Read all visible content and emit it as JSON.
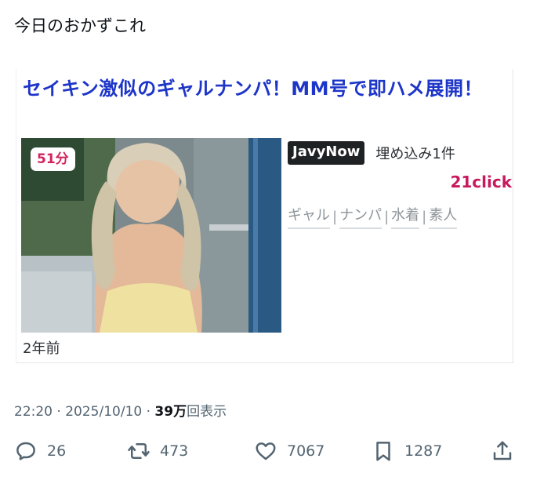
{
  "tweet": {
    "text": "今日のおかずこれ"
  },
  "card": {
    "title": "セイキン激似のギャルナンパ！MM号で即ハメ展開！",
    "duration": "51分",
    "age": "2年前",
    "source": "JavyNow",
    "embed_count": "埋め込み1件",
    "clicks": "21click",
    "tags": [
      "ギャル",
      "ナンパ",
      "水着",
      "素人"
    ]
  },
  "meta": {
    "time": "22:20",
    "date": "2025/10/10",
    "views": "39万",
    "views_suffix": "回表示"
  },
  "actions": {
    "replies": "26",
    "reposts": "473",
    "likes": "7067",
    "bookmarks": "1287"
  },
  "icons": {
    "reply": "reply-icon",
    "repost": "repost-icon",
    "like": "heart-icon",
    "bookmark": "bookmark-icon",
    "share": "share-icon"
  }
}
